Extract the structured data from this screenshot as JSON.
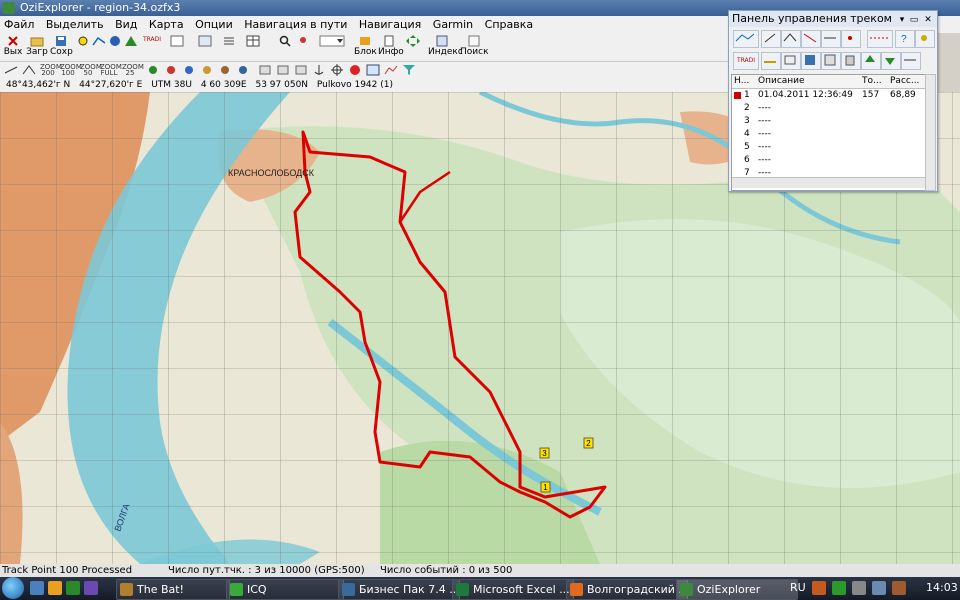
{
  "window": {
    "title": "OziExplorer - region-34.ozfx3"
  },
  "menu": [
    "Файл",
    "Выделить",
    "Вид",
    "Карта",
    "Опции",
    "Навигация в пути",
    "Навигация",
    "Garmin",
    "Справка"
  ],
  "toolbar": {
    "buttons": [
      {
        "label": "Вых",
        "icon": "exit-icon"
      },
      {
        "label": "Загр",
        "icon": "load-icon"
      },
      {
        "label": "Сохр",
        "icon": "save-icon"
      },
      {
        "label": "Инфо",
        "icon": "info-icon"
      },
      {
        "label": "Блок",
        "icon": "block-icon"
      },
      {
        "label": "Индекс",
        "icon": "index-icon"
      },
      {
        "label": "Поиск",
        "icon": "search-icon"
      }
    ],
    "small_labels": [
      "ZOOM 200",
      "ZOOM 100",
      "ZOOM 50",
      "ZOOM FULL",
      "ZOOM 25"
    ],
    "tradi_label": "TRADI"
  },
  "coords": {
    "lat": "48°43,462'г N",
    "lon": "44°27,620'г E",
    "utm": "UTM 38U",
    "east": "4 60 309E",
    "north": "53 97 050N",
    "datum": "Pulkovo 1942 (1)"
  },
  "bottom_status": {
    "left": "Track Point 100 Processed",
    "center": "Число пут.тчк. : 3 из 10000  (GPS:500)",
    "right": "Число событий : 0 из 500"
  },
  "panel": {
    "title": "Панель управления треком",
    "columns": [
      "Н...",
      "Описание",
      "То...",
      "Расс..."
    ],
    "rows": [
      {
        "num": "1",
        "desc": "01.04.2011 12:36:49",
        "points": "157",
        "dist": "68,89",
        "color": "#cc0000"
      },
      {
        "num": "2",
        "desc": "----"
      },
      {
        "num": "3",
        "desc": "----"
      },
      {
        "num": "4",
        "desc": "----"
      },
      {
        "num": "5",
        "desc": "----"
      },
      {
        "num": "6",
        "desc": "----"
      },
      {
        "num": "7",
        "desc": "----"
      }
    ]
  },
  "map": {
    "labels": [
      "КРАСНОСЛОБОДСК",
      "ВОЛГА"
    ],
    "waypoints": [
      "1",
      "2",
      "3"
    ],
    "track_color": "#dd0000"
  },
  "taskbar": {
    "tasks": [
      "The Bat!",
      "ICQ",
      "Бизнес Пак 7.4 ...",
      "Microsoft Excel ...",
      "Волгоградский ...",
      "OziExplorer"
    ],
    "lang": "RU",
    "time": "14:03"
  }
}
